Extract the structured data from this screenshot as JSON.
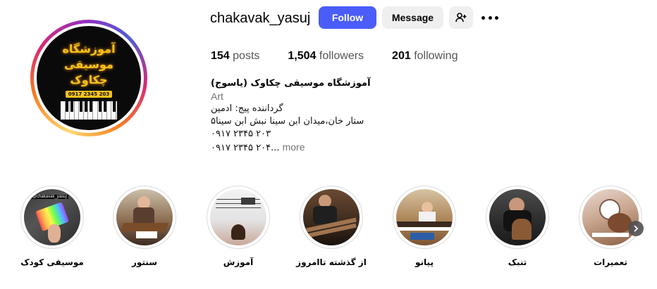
{
  "profile": {
    "username": "chakavak_yasuj",
    "follow_label": "Follow",
    "message_label": "Message",
    "add_user_icon": "add-person-icon",
    "more_icon": "more-horizontal-icon"
  },
  "avatar": {
    "line1": "آموزشگاه",
    "line2": "موسیقی",
    "line3": "چکاوک",
    "phone": "0917 2345 203"
  },
  "stats": {
    "posts_count": "154",
    "posts_label": "posts",
    "followers_count": "1,504",
    "followers_label": "followers",
    "following_count": "201",
    "following_label": "following"
  },
  "bio": {
    "name": "آموزشگاه موسیقی چکاوک (یاسوج)",
    "category": "Art",
    "line1": "گرداننده پیج: ادمین",
    "line2": "ستار خان،میدان ابن سینا نبش ابن سینا۵",
    "line3": "۰۹۱۷ ۲۳۴۵ ۲۰۳",
    "line4": "۰۹۱۷ ۲۳۴۵ ۲۰۴...",
    "more_label": "more"
  },
  "highlights": [
    {
      "label": "موسیقی کودک",
      "thumb_text": "@chakavak_yasuj"
    },
    {
      "label": "سنتور",
      "thumb_text": ""
    },
    {
      "label": "آموزش",
      "thumb_text": ""
    },
    {
      "label": "از گذشته تاامروز",
      "thumb_text": ""
    },
    {
      "label": "پیانو",
      "thumb_text": ""
    },
    {
      "label": "تنبک",
      "thumb_text": ""
    },
    {
      "label": "تعمیرات",
      "thumb_text": ""
    }
  ],
  "colors": {
    "follow_button": "#4a5df9",
    "secondary_button": "#efefef",
    "muted_text": "#737373"
  }
}
